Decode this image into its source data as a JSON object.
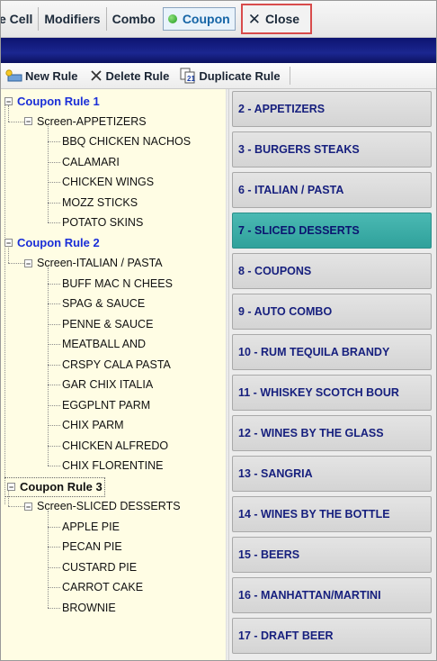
{
  "top_tabs": {
    "cell_label": "e Cell",
    "modifiers_label": "Modifiers",
    "combo_label": "Combo",
    "coupon_label": "Coupon",
    "close_label": "Close"
  },
  "toolbar": {
    "new_rule_label": "New Rule",
    "delete_rule_label": "Delete Rule",
    "duplicate_rule_label": "Duplicate Rule"
  },
  "rules": [
    {
      "name": "Coupon Rule 1",
      "screen": "Screen-APPETIZERS",
      "items": [
        "BBQ CHICKEN NACHOS",
        "CALAMARI",
        "CHICKEN WINGS",
        "MOZZ STICKS",
        "POTATO SKINS"
      ]
    },
    {
      "name": "Coupon Rule 2",
      "screen": "Screen-ITALIAN / PASTA",
      "items": [
        "BUFF MAC N CHEES",
        "SPAG & SAUCE",
        "PENNE & SAUCE",
        "MEATBALL AND",
        "CRSPY CALA PASTA",
        "GAR CHIX ITALIA",
        "EGGPLNT PARM",
        "CHIX PARM",
        "CHICKEN ALFREDO",
        "CHIX FLORENTINE"
      ]
    },
    {
      "name": "Coupon Rule 3",
      "screen": "Screen-SLICED DESSERTS",
      "items": [
        "APPLE PIE",
        "PECAN PIE",
        "CUSTARD PIE",
        "CARROT CAKE",
        "BROWNIE"
      ]
    }
  ],
  "screens": [
    "2 - APPETIZERS",
    "3 - BURGERS  STEAKS",
    "6 - ITALIAN / PASTA",
    "7 - SLICED DESSERTS",
    "8 - COUPONS",
    "9 - AUTO COMBO",
    "10 - RUM TEQUILA BRANDY",
    "11 - WHISKEY SCOTCH BOUR",
    "12 - WINES BY THE GLASS",
    "13 - SANGRIA",
    "14 - WINES BY THE BOTTLE",
    "15 - BEERS",
    "16 - MANHATTAN/MARTINI",
    "17 - DRAFT BEER"
  ],
  "selected_screen_index": 3,
  "active_rule_index": 2,
  "colors": {
    "navy_band": "#1b2691",
    "selected_screen": "#3aaca6",
    "rule_link": "#1a2ed8",
    "screen_text": "#17207e",
    "tree_background": "#fffde4",
    "close_highlight": "#d84b4b"
  }
}
